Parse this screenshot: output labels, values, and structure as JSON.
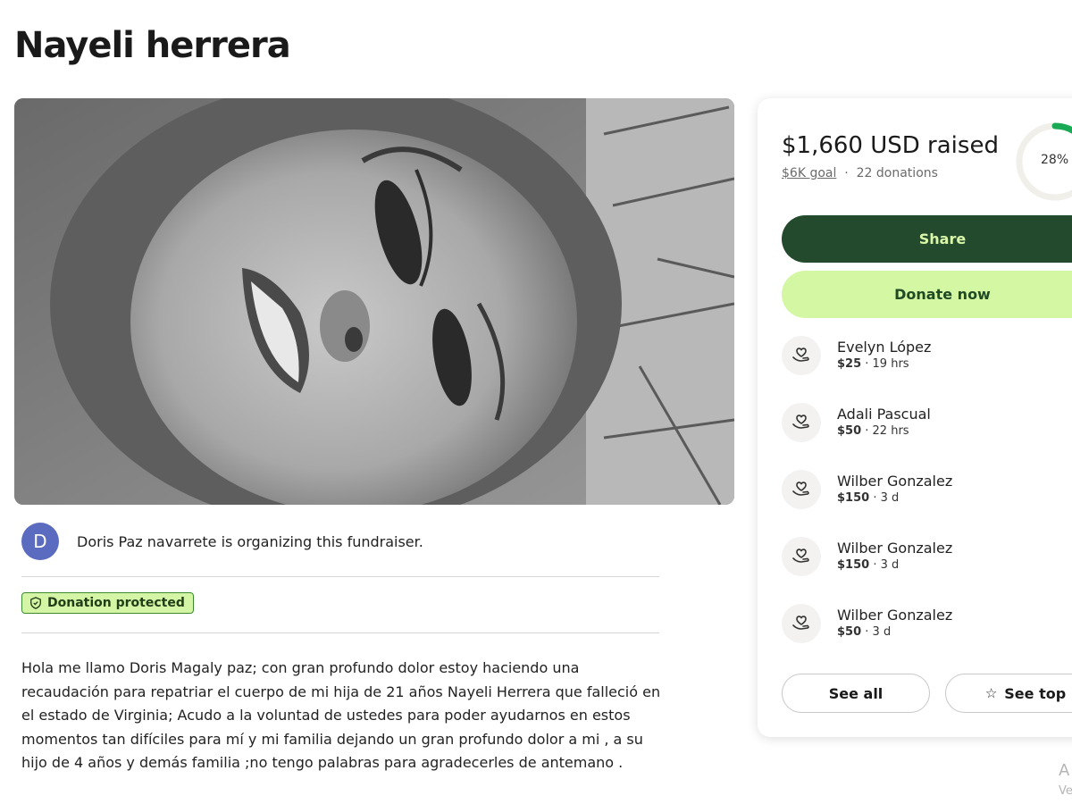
{
  "page": {
    "title": "Nayeli herrera"
  },
  "hero": {
    "description": "Black and white close-up photo"
  },
  "organizer": {
    "avatar_letter": "D",
    "text": "Doris Paz navarrete is organizing this fundraiser."
  },
  "badge": {
    "label": "Donation protected"
  },
  "story": {
    "text": "Hola me llamo Doris Magaly paz; con gran profundo dolor estoy haciendo una recaudación para repatriar el cuerpo de mi hija de 21 años Nayeli Herrera que falleció en el estado de Virginia; Acudo a la voluntad de ustedes para poder ayudarnos en estos momentos tan difíciles para mí y mi familia dejando un gran profundo dolor a mi , a su hijo de 4 años y demás familia ;no tengo palabras para agradecerles de antemano ."
  },
  "sidebar": {
    "raised": "$1,660 USD raised",
    "goal": "$6K goal",
    "separator": "·",
    "donation_count": "22 donations",
    "progress_percent": 28,
    "progress_label": "28%",
    "share_label": "Share",
    "donate_label": "Donate now",
    "donors": [
      {
        "name": "Evelyn López",
        "amount": "$25",
        "time": " · 19 hrs"
      },
      {
        "name": "Adali Pascual",
        "amount": "$50",
        "time": " · 22 hrs"
      },
      {
        "name": "Wilber Gonzalez",
        "amount": "$150",
        "time": " · 3 d"
      },
      {
        "name": "Wilber Gonzalez",
        "amount": "$150",
        "time": " · 3 d"
      },
      {
        "name": "Wilber Gonzalez",
        "amount": "$50",
        "time": " · 3 d"
      }
    ],
    "see_all_label": "See all",
    "see_top_label": "See top"
  },
  "corner": {
    "line1": "A",
    "line2": "Ve"
  },
  "colors": {
    "share_bg": "#244a2e",
    "donate_bg": "#d4f7a3",
    "progress": "#1aaa55",
    "avatar": "#5b6bbf"
  },
  "icons": {
    "donor": "heart-hand-icon",
    "badge": "shield-icon",
    "see_top": "star-icon"
  }
}
